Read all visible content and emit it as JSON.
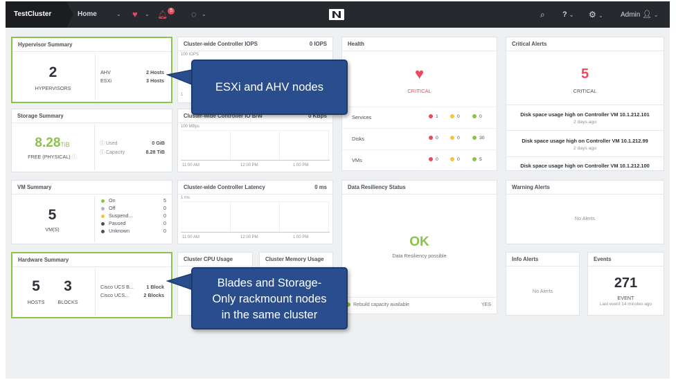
{
  "topbar": {
    "cluster_name": "TestCluster",
    "home": "Home",
    "alert_count": "5",
    "user": "Admin",
    "help": "?"
  },
  "hypervisor": {
    "title": "Hypervisor Summary",
    "count": "2",
    "count_label": "HYPERVISORS",
    "rows": [
      {
        "name": "AHV",
        "value": "2 Hosts"
      },
      {
        "name": "ESXi",
        "value": "3 Hosts"
      }
    ]
  },
  "iops": {
    "title": "Cluster-wide Controller IOPS",
    "value": "0 IOPS",
    "ylabel": "100 IOPS",
    "y_low": "1"
  },
  "bandwidth": {
    "title_visible": "Cluster-wide Controller IO B/W",
    "value": "0 KBps",
    "ylabel": "100 MBps",
    "x": [
      "11:00 AM",
      "12:00 PM",
      "1:00 PM"
    ]
  },
  "latency": {
    "title": "Cluster-wide Controller Latency",
    "value": "0 ms",
    "ylabel": "1 ms",
    "x": [
      "11:00 AM",
      "12:00 PM",
      "1:00 PM"
    ]
  },
  "cpu": {
    "title": "Cluster CPU Usage"
  },
  "memory": {
    "title": "Cluster Memory Usage"
  },
  "storage": {
    "title": "Storage Summary",
    "free": "8.28",
    "free_unit": "TiB",
    "free_label": "FREE (PHYSICAL)",
    "used_label": "Used",
    "used_value": "0 GiB",
    "cap_label": "Capacity",
    "cap_value": "8.28 TiB"
  },
  "vm": {
    "title": "VM Summary",
    "count": "5",
    "count_label": "VM(S)",
    "states": [
      {
        "name": "On",
        "value": "5",
        "color": "#8bc34a"
      },
      {
        "name": "Off",
        "value": "0",
        "color": "#b0b4b9"
      },
      {
        "name": "Suspend...",
        "value": "0",
        "color": "#f5c342"
      },
      {
        "name": "Paused",
        "value": "0",
        "color": "#4a4f55"
      },
      {
        "name": "Unknown",
        "value": "0",
        "color": "#4a4f55"
      }
    ]
  },
  "hardware": {
    "title": "Hardware Summary",
    "hosts": "5",
    "hosts_label": "HOSTS",
    "blocks": "3",
    "blocks_label": "BLOCKS",
    "rows": [
      {
        "name": "Cisco UCS B...",
        "value": "1 Block"
      },
      {
        "name": "Cisco UCS...",
        "value": "2 Blocks"
      }
    ]
  },
  "health": {
    "title": "Health",
    "status": "CRITICAL",
    "rows": [
      {
        "name": "Services",
        "red": "1",
        "yellow": "0",
        "green": "0"
      },
      {
        "name": "Disks",
        "red": "0",
        "yellow": "0",
        "green": "30"
      },
      {
        "name": "VMs",
        "red": "0",
        "yellow": "0",
        "green": "5"
      }
    ]
  },
  "resiliency": {
    "title": "Data Resiliency Status",
    "status": "OK",
    "sub": "Data Resiliency possible",
    "rebuild": "Rebuild capacity available",
    "rebuild_value": "YES"
  },
  "critical": {
    "title": "Critical Alerts",
    "count": "5",
    "label": "CRITICAL",
    "items": [
      {
        "text": "Disk space usage high on Controller VM 10.1.212.101",
        "time": "2 days ago"
      },
      {
        "text": "Disk space usage high on Controller VM 10.1.212.99",
        "time": "2 days ago"
      },
      {
        "text": "Disk space usage high on Controller VM 10.1.212.100",
        "time": ""
      }
    ]
  },
  "warning": {
    "title": "Warning Alerts",
    "empty": "No Alerts"
  },
  "info": {
    "title": "Info Alerts",
    "empty": "No Alerts"
  },
  "events": {
    "title": "Events",
    "count": "271",
    "label": "EVENT",
    "last": "Last event 14 minutes ago"
  },
  "callouts": {
    "top": "ESXi and AHV nodes",
    "bottom_1": "Blades and Storage-",
    "bottom_2": "Only rackmount nodes",
    "bottom_3": "in the same cluster"
  },
  "colors": {
    "accent_green": "#8bc34a",
    "critical_red": "#e84a5f",
    "callout_blue": "#2a4e8d"
  }
}
